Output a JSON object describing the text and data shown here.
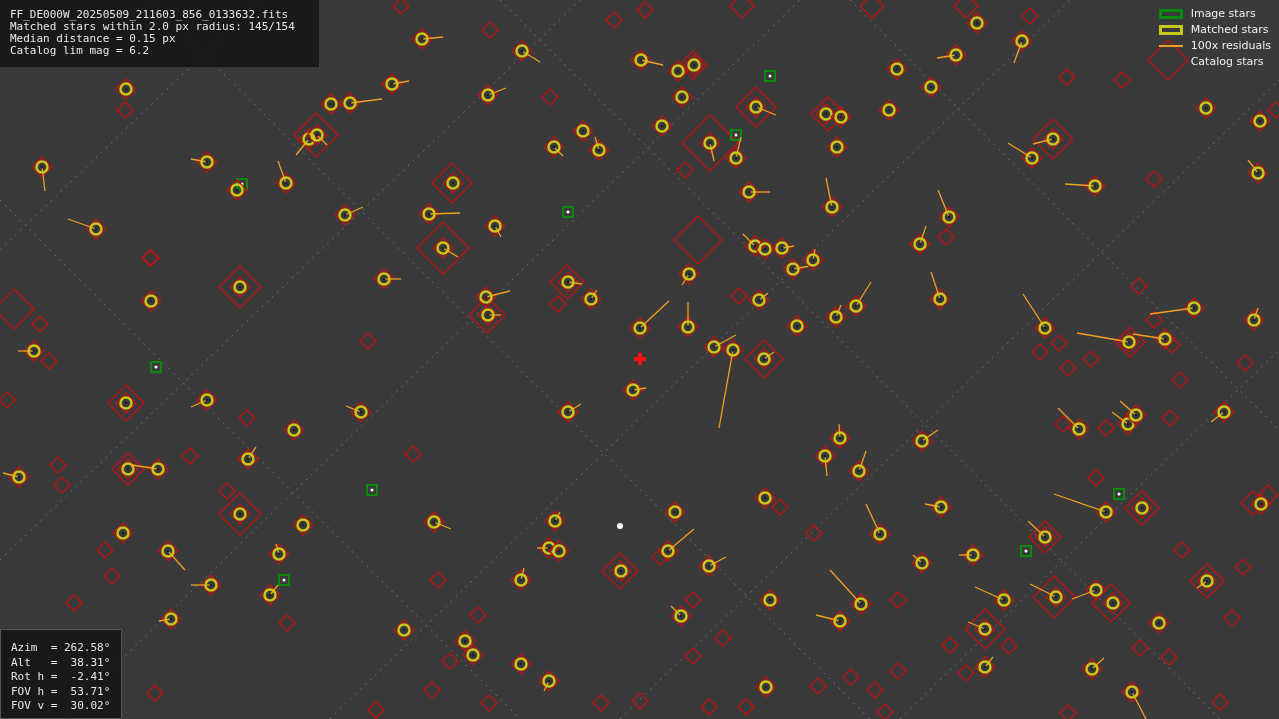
{
  "info": {
    "lines": [
      "FF_DE000W_20250509_211603_856_0133632.fits",
      "Matched stars within 2.0 px radius: 145/154",
      "Median distance = 0.15 px",
      "Catalog lim mag = 6.2"
    ]
  },
  "legend": [
    {
      "kind": "image",
      "label": "Image stars"
    },
    {
      "kind": "matched",
      "label": "Matched stars"
    },
    {
      "kind": "residual",
      "label": "100x residuals"
    },
    {
      "kind": "catalog",
      "label": "Catalog stars"
    }
  ],
  "pointing": {
    "lines": [
      "Azim  = 262.58°",
      "Alt   =  38.31°",
      "Rot h =  -2.41°",
      "FOV h =  53.71°",
      "FOV v =  30.02°"
    ]
  }
}
